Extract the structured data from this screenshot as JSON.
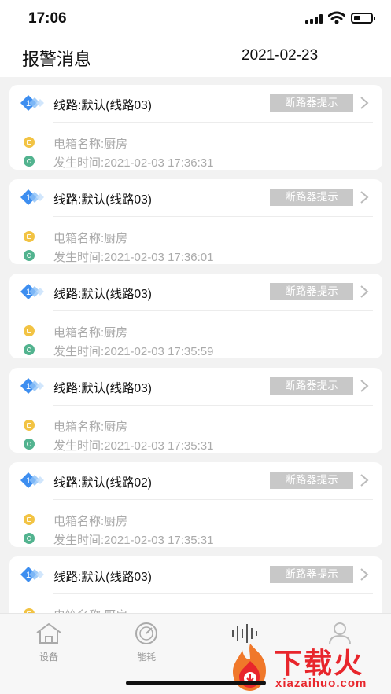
{
  "status_bar": {
    "time": "17:06"
  },
  "header": {
    "title": "报警消息",
    "date": "2021-02-23"
  },
  "alarms": [
    {
      "badge_number": "1",
      "title": "线路:默认(线路03)",
      "tag": "断路器提示",
      "box_name": "电箱名称:厨房",
      "occurred": "发生时间:2021-02-03 17:36:31"
    },
    {
      "badge_number": "1",
      "title": "线路:默认(线路03)",
      "tag": "断路器提示",
      "box_name": "电箱名称:厨房",
      "occurred": "发生时间:2021-02-03 17:36:01"
    },
    {
      "badge_number": "1",
      "title": "线路:默认(线路03)",
      "tag": "断路器提示",
      "box_name": "电箱名称:厨房",
      "occurred": "发生时间:2021-02-03 17:35:59"
    },
    {
      "badge_number": "1",
      "title": "线路:默认(线路03)",
      "tag": "断路器提示",
      "box_name": "电箱名称:厨房",
      "occurred": "发生时间:2021-02-03 17:35:31"
    },
    {
      "badge_number": "1",
      "title": "线路:默认(线路02)",
      "tag": "断路器提示",
      "box_name": "电箱名称:厨房",
      "occurred": "发生时间:2021-02-03 17:35:31"
    },
    {
      "badge_number": "1",
      "title": "线路:默认(线路03)",
      "tag": "断路器提示",
      "box_name": "电箱名称:厨房",
      "occurred": ""
    }
  ],
  "tabbar": {
    "tabs": [
      {
        "label": "设备",
        "icon": "home-icon"
      },
      {
        "label": "能耗",
        "icon": "gauge-icon"
      },
      {
        "label": "",
        "icon": "soundwave-icon"
      },
      {
        "label": "",
        "icon": "user-icon"
      }
    ]
  },
  "watermark": {
    "text": "下载火",
    "sub": "xiazaihuo.com"
  },
  "colors": {
    "tag_bg": "#c8c8c8",
    "badge_blue": "#3d8ef0",
    "dot_yellow": "#f2c343",
    "dot_green": "#52b38f",
    "watermark_red": "#e8262c"
  }
}
